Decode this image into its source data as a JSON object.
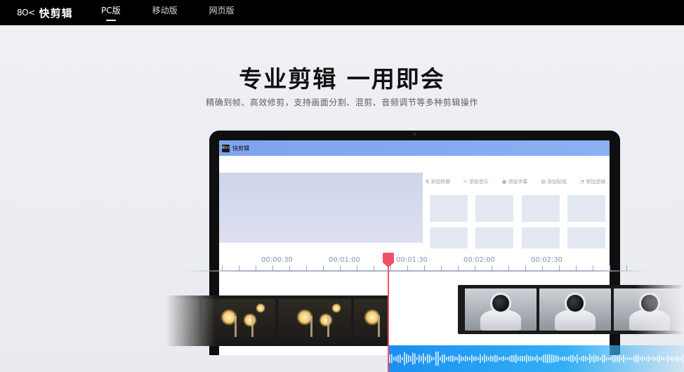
{
  "header": {
    "brand_logo": "8O<",
    "brand_name": "快剪辑",
    "tabs": [
      {
        "label": "PC版",
        "active": true
      },
      {
        "label": "移动版",
        "active": false
      },
      {
        "label": "网页版",
        "active": false
      }
    ]
  },
  "hero": {
    "headline": "专业剪辑 一用即会",
    "subline": "精确到帧、高效修剪，支持画面分割、混剪、音频调节等多种剪辑操作"
  },
  "laptop": {
    "app_logo": "8O<",
    "app_name": "快剪辑",
    "tools": [
      {
        "icon": "crop-icon",
        "label": "添加剪辑"
      },
      {
        "icon": "scissors-icon",
        "label": "添加音乐"
      },
      {
        "icon": "subtitle-icon",
        "label": "添加字幕"
      },
      {
        "icon": "sticker-icon",
        "label": "添加贴纸"
      },
      {
        "icon": "filter-icon",
        "label": "添加滤镜"
      }
    ]
  },
  "timeline": {
    "labels": [
      "00:00:30",
      "00:01:00",
      "00:01:30",
      "00:02:00",
      "00:02:30"
    ]
  },
  "colors": {
    "nav_bg": "#000000",
    "accent_playhead": "#f0506a",
    "app_bar": "#8cb0f2",
    "waveform": "#1a8ff0"
  }
}
